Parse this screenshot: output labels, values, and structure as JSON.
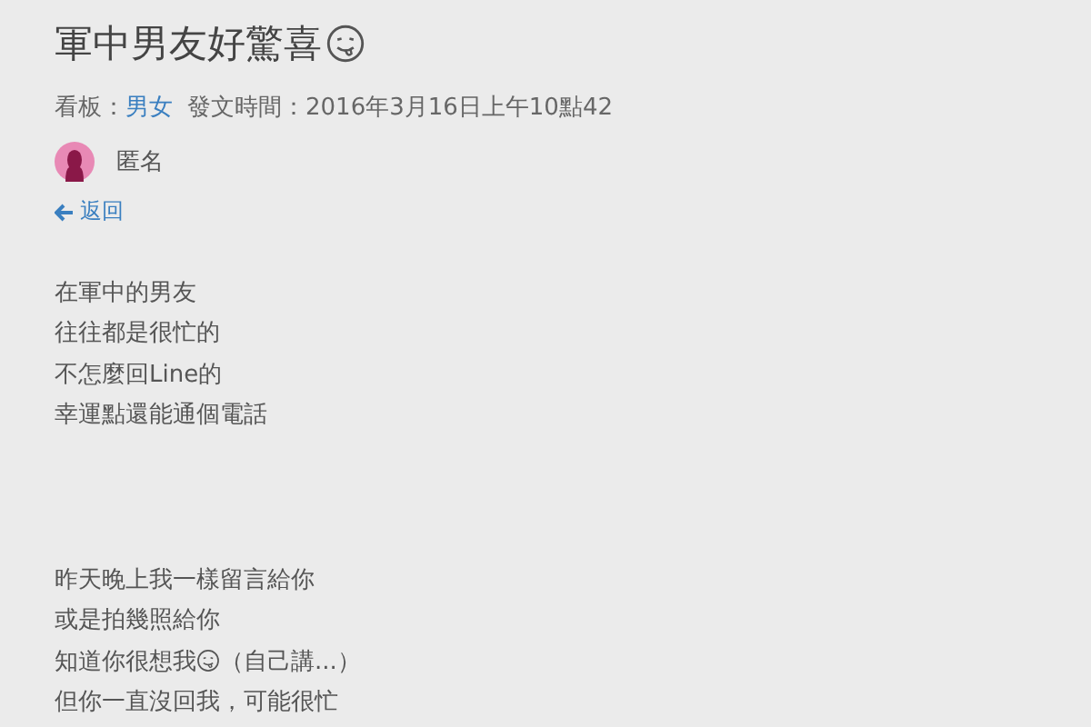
{
  "post": {
    "title": "軍中男友好驚喜",
    "board_label": "看板：",
    "board": "男女",
    "posted": "發文時間：2016年3月16日上午10點42",
    "author": "匿名",
    "back": "返回"
  },
  "paragraphs": [
    {
      "lines": [
        {
          "kind": "text",
          "text": "在軍中的男友"
        },
        {
          "kind": "text",
          "text": "往往都是很忙的"
        },
        {
          "kind": "text",
          "text": "不怎麼回Line的"
        },
        {
          "kind": "text",
          "text": "幸運點還能通個電話"
        }
      ]
    },
    {
      "lines": [
        {
          "kind": "text",
          "text": "昨天晚上我一樣留言給你"
        },
        {
          "kind": "text",
          "text": "或是拍幾照給你"
        },
        {
          "kind": "emoji",
          "text": "知道你很想我",
          "after": "（自己講...）"
        },
        {
          "kind": "text",
          "text": "但你一直沒回我，可能很忙"
        }
      ]
    }
  ]
}
